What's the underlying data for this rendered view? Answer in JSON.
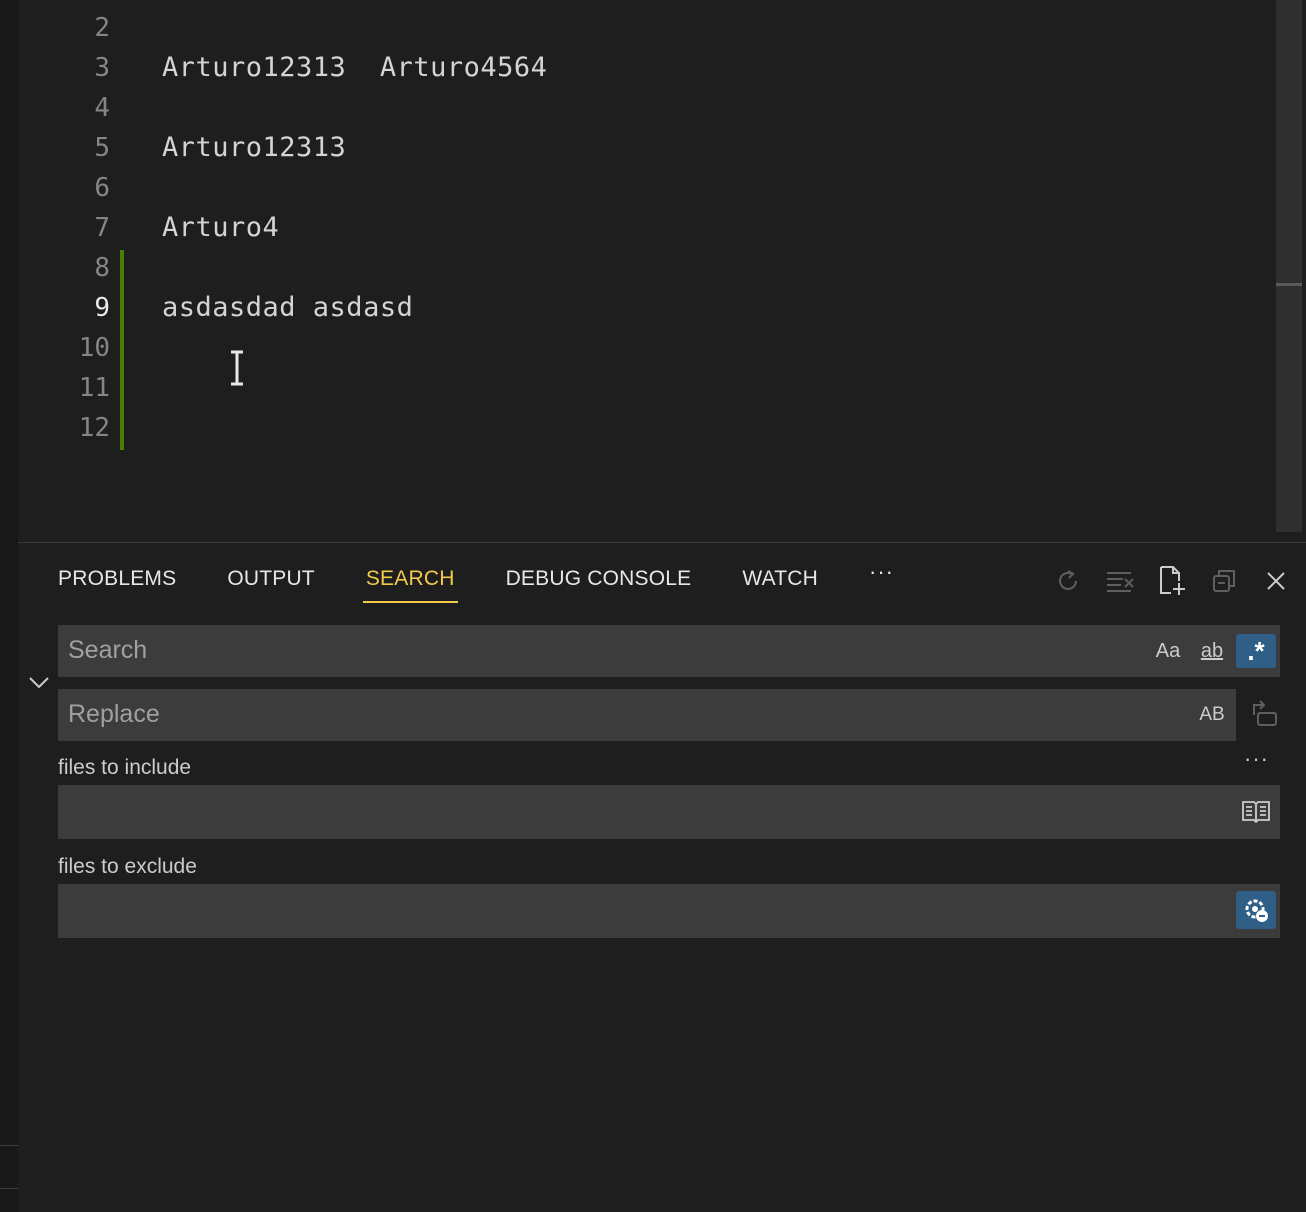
{
  "editor": {
    "lines": [
      {
        "number": "2",
        "text": ""
      },
      {
        "number": "3",
        "text": "Arturo12313  Arturo4564"
      },
      {
        "number": "4",
        "text": ""
      },
      {
        "number": "5",
        "text": "Arturo12313"
      },
      {
        "number": "6",
        "text": ""
      },
      {
        "number": "7",
        "text": "Arturo4"
      },
      {
        "number": "8",
        "text": ""
      },
      {
        "number": "9",
        "text": "asdasdad asdasd"
      },
      {
        "number": "10",
        "text": ""
      },
      {
        "number": "11",
        "text": ""
      },
      {
        "number": "12",
        "text": ""
      }
    ],
    "active_line": "9"
  },
  "panel": {
    "tabs": [
      {
        "label": "PROBLEMS"
      },
      {
        "label": "OUTPUT"
      },
      {
        "label": "SEARCH"
      },
      {
        "label": "DEBUG CONSOLE"
      },
      {
        "label": "WATCH"
      }
    ],
    "active_tab": "SEARCH",
    "more_label": "···"
  },
  "search": {
    "search_placeholder": "Search",
    "replace_placeholder": "Replace",
    "match_case_label": "Aa",
    "whole_word_label": "ab",
    "regex_label": ".*",
    "preserve_case_label": "AB",
    "files_to_include_label": "files to include",
    "files_to_exclude_label": "files to exclude",
    "more_options_label": "···"
  },
  "colors": {
    "accent_tab": "#f2c94c",
    "gutter_modified": "#487e02",
    "toggle_active": "#2f5e86"
  }
}
